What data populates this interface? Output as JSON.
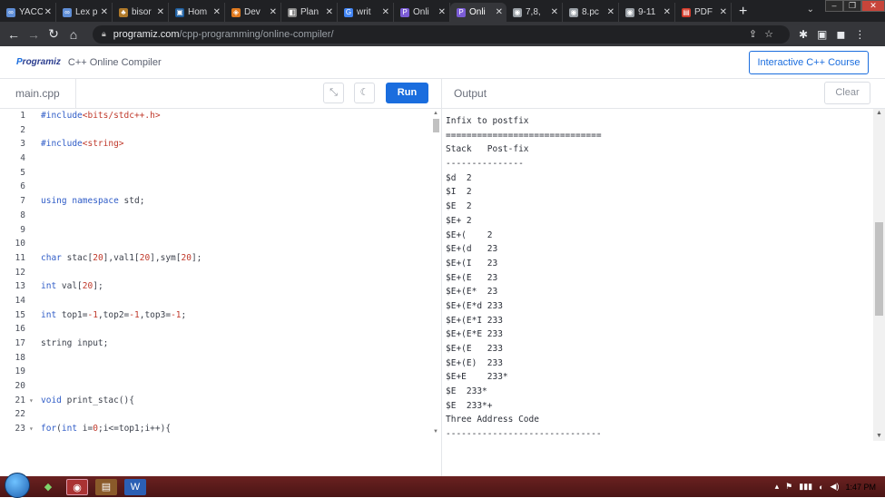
{
  "browser": {
    "tabs": [
      {
        "label": "YACC",
        "icon": "tab-favicon-icon",
        "color": "#5f8ed6",
        "glyph": "∞"
      },
      {
        "label": "Lex p",
        "icon": "tab-favicon-icon",
        "color": "#5f8ed6",
        "glyph": "∞"
      },
      {
        "label": "bisor",
        "icon": "tab-favicon-icon",
        "color": "#b07a2a",
        "glyph": "♣"
      },
      {
        "label": "Hom",
        "icon": "tab-favicon-icon",
        "color": "#1e5fa0",
        "glyph": "▣"
      },
      {
        "label": "Dev",
        "icon": "tab-favicon-icon",
        "color": "#e07a1f",
        "glyph": "◈"
      },
      {
        "label": "Plan",
        "icon": "tab-favicon-icon",
        "color": "#888888",
        "glyph": "◧"
      },
      {
        "label": "writ",
        "icon": "tab-favicon-icon",
        "color": "#4285f4",
        "glyph": "G"
      },
      {
        "label": "Onli",
        "icon": "tab-favicon-icon",
        "color": "#7b5cd6",
        "glyph": "P"
      },
      {
        "label": "Onli",
        "icon": "tab-favicon-icon",
        "color": "#7b5cd6",
        "glyph": "P"
      },
      {
        "label": "7,8,",
        "icon": "tab-favicon-icon",
        "color": "#9aa0a6",
        "glyph": "◉"
      },
      {
        "label": "8.pc",
        "icon": "tab-favicon-icon",
        "color": "#9aa0a6",
        "glyph": "◉"
      },
      {
        "label": "9-11",
        "icon": "tab-favicon-icon",
        "color": "#9aa0a6",
        "glyph": "◉"
      },
      {
        "label": "PDF",
        "icon": "tab-favicon-icon",
        "color": "#d33b2b",
        "glyph": "▤"
      }
    ],
    "close_glyph": "✕",
    "new_tab_glyph": "+",
    "address_domain": "programiz.com",
    "address_path": "/cpp-programming/online-compiler/"
  },
  "site": {
    "logo_text": "rogramiz",
    "logo_letter": "P",
    "page_title": "C++ Online Compiler",
    "course_button": "Interactive C++ Course"
  },
  "toolbar": {
    "file_name": "main.cpp",
    "run_label": "Run",
    "output_label": "Output",
    "clear_label": "Clear"
  },
  "editor_lines": [
    {
      "n": "1",
      "fold": "",
      "parts": [
        [
          "kw",
          "#include"
        ],
        [
          "hdr",
          "<bits/stdc++.h>"
        ]
      ]
    },
    {
      "n": "2",
      "fold": "",
      "parts": []
    },
    {
      "n": "3",
      "fold": "",
      "parts": [
        [
          "kw",
          "#include"
        ],
        [
          "hdr",
          "<string>"
        ]
      ]
    },
    {
      "n": "4",
      "fold": "",
      "parts": []
    },
    {
      "n": "5",
      "fold": "",
      "parts": []
    },
    {
      "n": "6",
      "fold": "",
      "parts": []
    },
    {
      "n": "7",
      "fold": "",
      "parts": [
        [
          "kw",
          "using"
        ],
        [
          "code",
          " "
        ],
        [
          "kw",
          "namespace"
        ],
        [
          "code",
          " std;"
        ]
      ]
    },
    {
      "n": "8",
      "fold": "",
      "parts": []
    },
    {
      "n": "9",
      "fold": "",
      "parts": []
    },
    {
      "n": "10",
      "fold": "",
      "parts": []
    },
    {
      "n": "11",
      "fold": "",
      "parts": [
        [
          "kw",
          "char"
        ],
        [
          "code",
          " stac["
        ],
        [
          "num",
          "20"
        ],
        [
          "code",
          "],val1["
        ],
        [
          "num",
          "20"
        ],
        [
          "code",
          "],sym["
        ],
        [
          "num",
          "20"
        ],
        [
          "code",
          "];"
        ]
      ]
    },
    {
      "n": "12",
      "fold": "",
      "parts": []
    },
    {
      "n": "13",
      "fold": "",
      "parts": [
        [
          "kw",
          "int"
        ],
        [
          "code",
          " val["
        ],
        [
          "num",
          "20"
        ],
        [
          "code",
          "];"
        ]
      ]
    },
    {
      "n": "14",
      "fold": "",
      "parts": []
    },
    {
      "n": "15",
      "fold": "",
      "parts": [
        [
          "kw",
          "int"
        ],
        [
          "code",
          " top1="
        ],
        [
          "num",
          "-1"
        ],
        [
          "code",
          ",top2="
        ],
        [
          "num",
          "-1"
        ],
        [
          "code",
          ",top3="
        ],
        [
          "num",
          "-1"
        ],
        [
          "code",
          ";"
        ]
      ]
    },
    {
      "n": "16",
      "fold": "",
      "parts": []
    },
    {
      "n": "17",
      "fold": "",
      "parts": [
        [
          "code",
          "string input;"
        ]
      ]
    },
    {
      "n": "18",
      "fold": "",
      "parts": []
    },
    {
      "n": "19",
      "fold": "",
      "parts": []
    },
    {
      "n": "20",
      "fold": "",
      "parts": []
    },
    {
      "n": "21",
      "fold": "▾",
      "parts": [
        [
          "kw",
          "void"
        ],
        [
          "code",
          " print_stac(){"
        ]
      ]
    },
    {
      "n": "22",
      "fold": "",
      "parts": []
    },
    {
      "n": "23",
      "fold": "▾",
      "parts": [
        [
          "kw",
          "for"
        ],
        [
          "code",
          "("
        ],
        [
          "kw",
          "int"
        ],
        [
          "code",
          " i="
        ],
        [
          "num",
          "0"
        ],
        [
          "code",
          ";i<=top1;i++){"
        ]
      ]
    }
  ],
  "output_lines": [
    "Infix to postfix",
    "==============================",
    "Stack   Post-fix",
    "---------------",
    "$d  2",
    "$I  2",
    "$E  2",
    "$E+ 2",
    "$E+(    2",
    "$E+(d   23",
    "$E+(I   23",
    "$E+(E   23",
    "$E+(E*  23",
    "$E+(E*d 233",
    "$E+(E*I 233",
    "$E+(E*E 233",
    "$E+(E   233",
    "$E+(E)  233",
    "$E+E    233*",
    "$E  233*",
    "$E  233*+",
    "Three Address Code",
    "------------------------------"
  ],
  "taskbar": {
    "clock": "1:47 PM",
    "tray_glyphs": [
      "▴",
      "⚑",
      "▮▮▮",
      "◐",
      "◀)"
    ]
  }
}
